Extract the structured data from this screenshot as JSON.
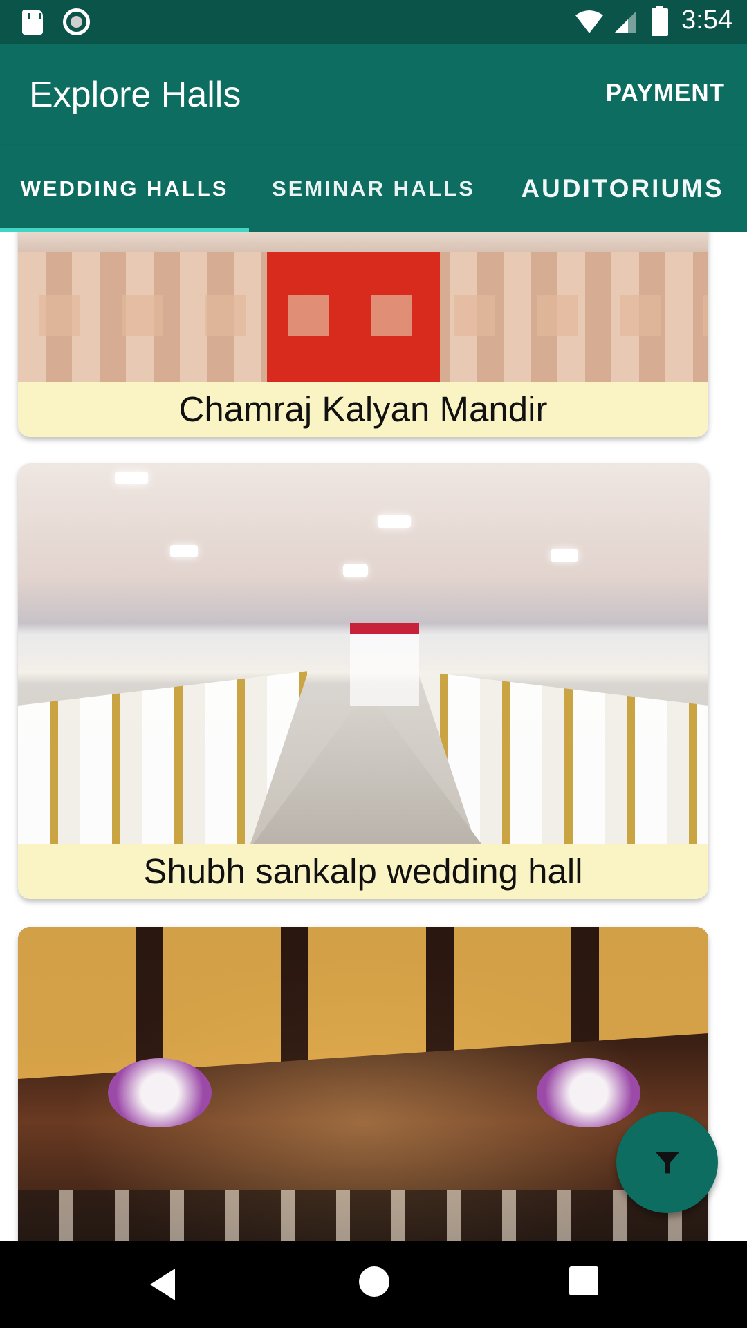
{
  "status_bar": {
    "time": "3:54",
    "icons": [
      "sd-card-icon",
      "sync-ring-icon",
      "wifi-icon",
      "signal-icon",
      "battery-icon"
    ]
  },
  "app_bar": {
    "title": "Explore Halls",
    "action_label": "PAYMENT"
  },
  "tabs": [
    {
      "label": "WEDDING HALLS",
      "selected": true
    },
    {
      "label": "SEMINAR HALLS",
      "selected": false
    },
    {
      "label": "AUDITORIUMS",
      "selected": false
    }
  ],
  "halls": [
    {
      "name": "Chamraj Kalyan Mandir"
    },
    {
      "name": "Shubh sankalp wedding hall"
    },
    {
      "name": ""
    }
  ],
  "fab": {
    "icon": "filter-icon"
  },
  "nav_bar": {
    "icons": [
      "back-icon",
      "home-icon",
      "recents-icon"
    ]
  },
  "colors": {
    "primary": "#0c6d60",
    "primary_dark": "#0b544a",
    "accent": "#41d6c3",
    "caption_bg": "#faf4c5"
  }
}
